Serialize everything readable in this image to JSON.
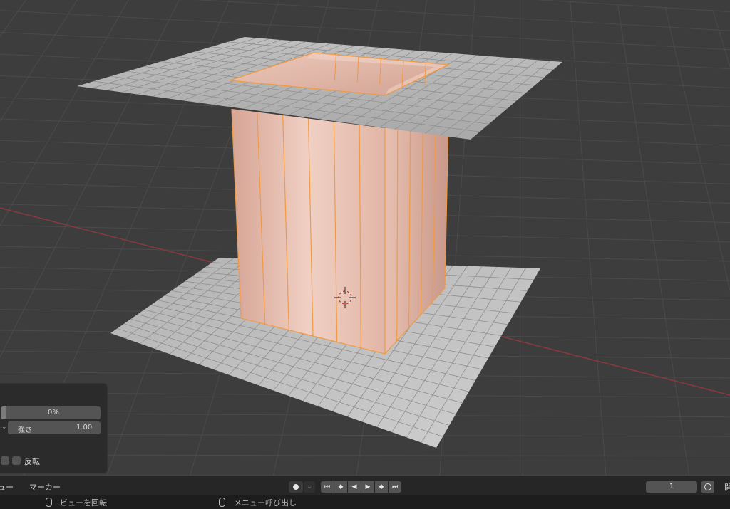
{
  "operator_panel": {
    "percent_value": "0%",
    "strength_label": "強さ",
    "strength_value": "1.00",
    "invert_label": "反転"
  },
  "timeline": {
    "menu_view": "ビュー",
    "menu_marker": "マーカー",
    "current_frame": "1",
    "cutoff_label": "開"
  },
  "status_bar": {
    "rotate_view": "ビューを回転",
    "call_menu": "メニュー呼び出し"
  },
  "colors": {
    "background": "#3d3d3d",
    "grid_line": "#4a4a4a",
    "x_axis": "#8a3a3f",
    "mesh_gray": "#b8b8b8",
    "mesh_skin": "#e0b3a3",
    "edge_orange": "#f09a45"
  }
}
